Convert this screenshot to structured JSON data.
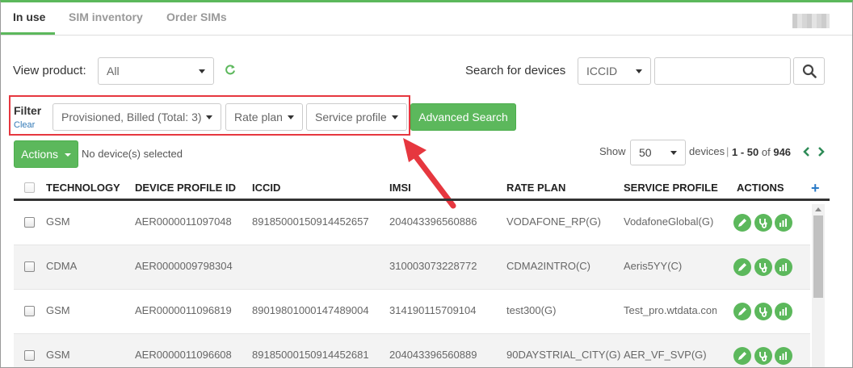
{
  "tabs": [
    {
      "label": "In use"
    },
    {
      "label": "SIM inventory"
    },
    {
      "label": "Order SIMs"
    }
  ],
  "view_product": {
    "label": "View product:",
    "value": "All"
  },
  "search": {
    "label": "Search for devices",
    "field": "ICCID",
    "query": ""
  },
  "filter": {
    "title": "Filter",
    "clear": "Clear",
    "status_select": "Provisioned, Billed (Total: 3)",
    "rate_plan_select": "Rate plan",
    "service_profile_select": "Service profile",
    "advanced_search": "Advanced Search"
  },
  "actions": {
    "button": "Actions",
    "selection": "No device(s) selected"
  },
  "pagination": {
    "show_label": "Show",
    "page_size": "50",
    "devices_label": "devices",
    "range": "1 - 50",
    "of_label": "of",
    "total": "946"
  },
  "table": {
    "columns": [
      "TECHNOLOGY",
      "DEVICE PROFILE ID",
      "ICCID",
      "IMSI",
      "RATE PLAN",
      "SERVICE PROFILE",
      "ACTIONS"
    ],
    "rows": [
      {
        "technology": "GSM",
        "device_profile_id": "AER0000011097048",
        "iccid": "89185000150914452657",
        "imsi": "204043396560886",
        "rate_plan": "VODAFONE_RP(G)",
        "service_profile": "VodafoneGlobal(G)"
      },
      {
        "technology": "CDMA",
        "device_profile_id": "AER0000009798304",
        "iccid": "",
        "imsi": "310003073228772",
        "rate_plan": "CDMA2INTRO(C)",
        "service_profile": "Aeris5YY(C)"
      },
      {
        "technology": "GSM",
        "device_profile_id": "AER0000011096819",
        "iccid": "89019801000147489004",
        "imsi": "314190115709104",
        "rate_plan": "test300(G)",
        "service_profile": "Test_pro.wtdata.com"
      },
      {
        "technology": "GSM",
        "device_profile_id": "AER0000011096608",
        "iccid": "89185000150914452681",
        "imsi": "204043396560889",
        "rate_plan": "90DAYSTRIAL_CITY(G)",
        "service_profile": "AER_VF_SVP(G)"
      }
    ]
  },
  "colors": {
    "accent": "#5cb85c",
    "highlight": "#e6373f",
    "link": "#337ab7"
  }
}
